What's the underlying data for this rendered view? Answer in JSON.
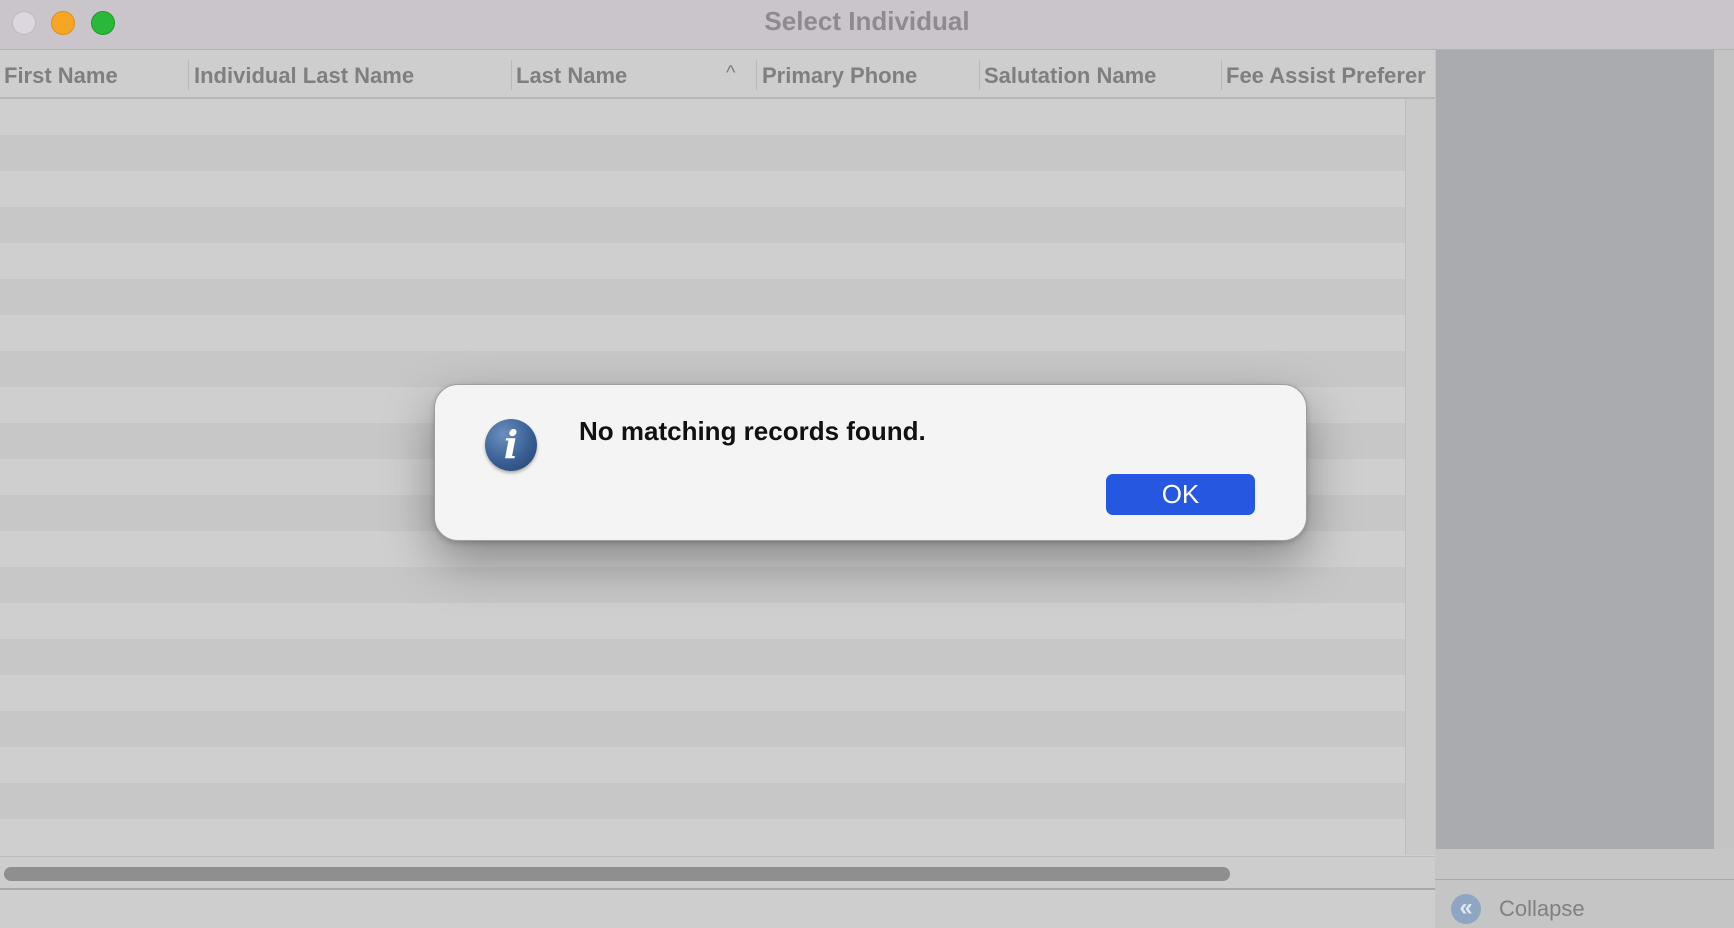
{
  "window": {
    "title": "Select Individual"
  },
  "table": {
    "columns": [
      "First Name",
      "Individual Last Name",
      "Last Name",
      "Primary Phone",
      "Salutation Name",
      "Fee Assist Preferer"
    ],
    "sorted_column": "Last Name",
    "sort_direction": "ascending",
    "sort_icon": "^",
    "rows": []
  },
  "dialog": {
    "icon": "info-icon",
    "icon_glyph": "i",
    "message": "No matching records found.",
    "ok_label": "OK",
    "ok_color": "#2557e0"
  },
  "side_panel": {
    "collapse_icon": "double-chevron-left-icon",
    "collapse_glyph": "«",
    "collapse_label": "Collapse"
  },
  "colors": {
    "close": "#dcd7de",
    "minimize": "#f6a623",
    "maximize": "#29b83a"
  }
}
